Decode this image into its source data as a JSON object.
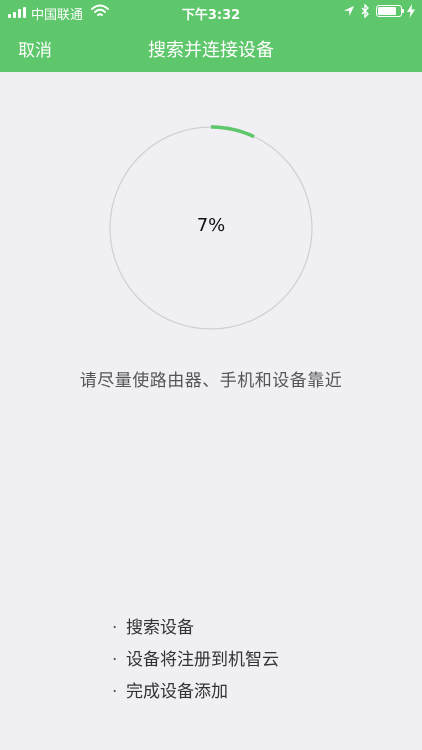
{
  "status_bar": {
    "carrier": "中国联通",
    "time": "下午3:32",
    "battery_level": 0.85,
    "icons": [
      "signal-icon",
      "wifi-icon",
      "location-icon",
      "bluetooth-icon",
      "battery-icon",
      "charging-icon"
    ]
  },
  "nav": {
    "cancel_label": "取消",
    "title": "搜索并连接设备"
  },
  "progress": {
    "value": 7,
    "label": "7%"
  },
  "hint": "请尽量使路由器、手机和设备靠近",
  "steps": [
    {
      "bullet": "·",
      "label": "搜索设备"
    },
    {
      "bullet": "·",
      "label": "设备将注册到机智云"
    },
    {
      "bullet": "·",
      "label": "完成设备添加"
    }
  ],
  "colors": {
    "brand": "#5ec66b",
    "background": "#efeff4",
    "ring_track": "#cfcfd3"
  }
}
